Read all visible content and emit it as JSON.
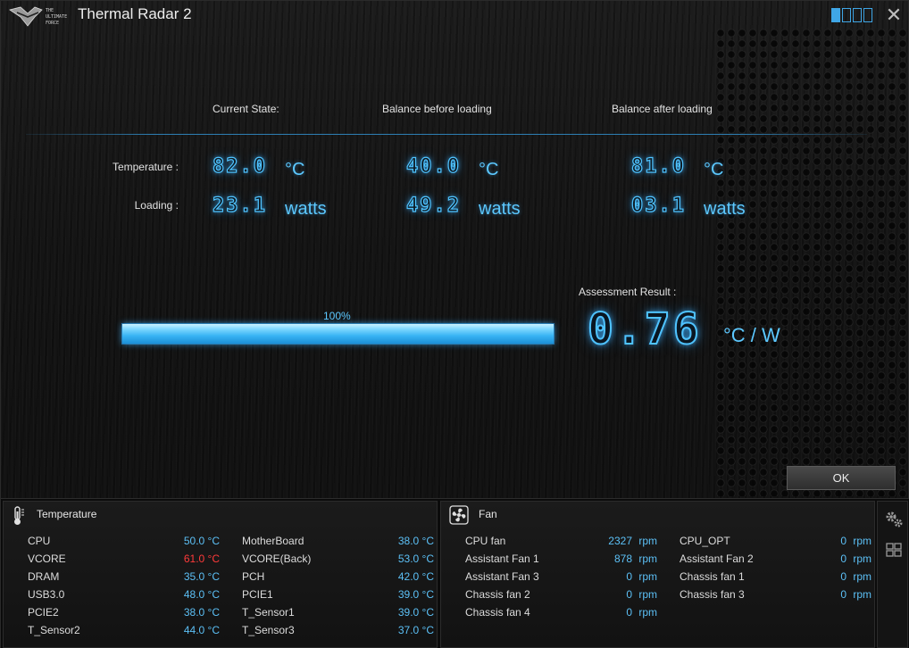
{
  "window": {
    "title": "Thermal Radar 2"
  },
  "logo_text": [
    "THE",
    "ULTIMATE",
    "FORCE"
  ],
  "headers": {
    "current": "Current State:",
    "before": "Balance before loading",
    "after": "Balance after loading"
  },
  "rows": {
    "temperature_label": "Temperature :",
    "loading_label": "Loading :"
  },
  "values": {
    "current": {
      "temperature": "82.0",
      "loading": "23.1"
    },
    "before": {
      "temperature": "40.0",
      "loading": "49.2"
    },
    "after": {
      "temperature": "81.0",
      "loading": "03.1"
    }
  },
  "units": {
    "temperature": "°C",
    "loading": "watts"
  },
  "progress": {
    "label": "100%",
    "fraction": 1.0
  },
  "assessment": {
    "label": "Assessment Result :",
    "value": "0.76",
    "unit": "°C / W"
  },
  "ok_label": "OK",
  "temperature_panel": {
    "title": "Temperature",
    "items": [
      {
        "name": "CPU",
        "value": "50.0 °C",
        "status": "normal"
      },
      {
        "name": "MotherBoard",
        "value": "38.0 °C",
        "status": "normal"
      },
      {
        "name": "VCORE",
        "value": "61.0 °C",
        "status": "hot"
      },
      {
        "name": "VCORE(Back)",
        "value": "53.0 °C",
        "status": "normal"
      },
      {
        "name": "DRAM",
        "value": "35.0 °C",
        "status": "normal"
      },
      {
        "name": "PCH",
        "value": "42.0 °C",
        "status": "normal"
      },
      {
        "name": "USB3.0",
        "value": "48.0 °C",
        "status": "normal"
      },
      {
        "name": "PCIE1",
        "value": "39.0 °C",
        "status": "normal"
      },
      {
        "name": "PCIE2",
        "value": "38.0 °C",
        "status": "normal"
      },
      {
        "name": "T_Sensor1",
        "value": "39.0 °C",
        "status": "normal"
      },
      {
        "name": "T_Sensor2",
        "value": "44.0 °C",
        "status": "normal"
      },
      {
        "name": "T_Sensor3",
        "value": "37.0 °C",
        "status": "normal"
      }
    ]
  },
  "fan_panel": {
    "title": "Fan",
    "unit": "rpm",
    "items": [
      {
        "name": "CPU fan",
        "value": "2327"
      },
      {
        "name": "CPU_OPT",
        "value": "0"
      },
      {
        "name": "Assistant Fan 1",
        "value": "878"
      },
      {
        "name": "Assistant Fan 2",
        "value": "0"
      },
      {
        "name": "Assistant Fan 3",
        "value": "0"
      },
      {
        "name": "Chassis fan 1",
        "value": "0"
      },
      {
        "name": "Chassis fan 2",
        "value": "0"
      },
      {
        "name": "Chassis fan 3",
        "value": "0"
      },
      {
        "name": "Chassis fan 4",
        "value": "0"
      }
    ]
  },
  "colors": {
    "accent": "#4fc3ff",
    "alert": "#ff3a3a"
  },
  "icons": [
    "logo-icon",
    "layout-switch-icon",
    "close-icon",
    "thermometer-icon",
    "fan-icon",
    "gear-icon",
    "grid-icon"
  ]
}
